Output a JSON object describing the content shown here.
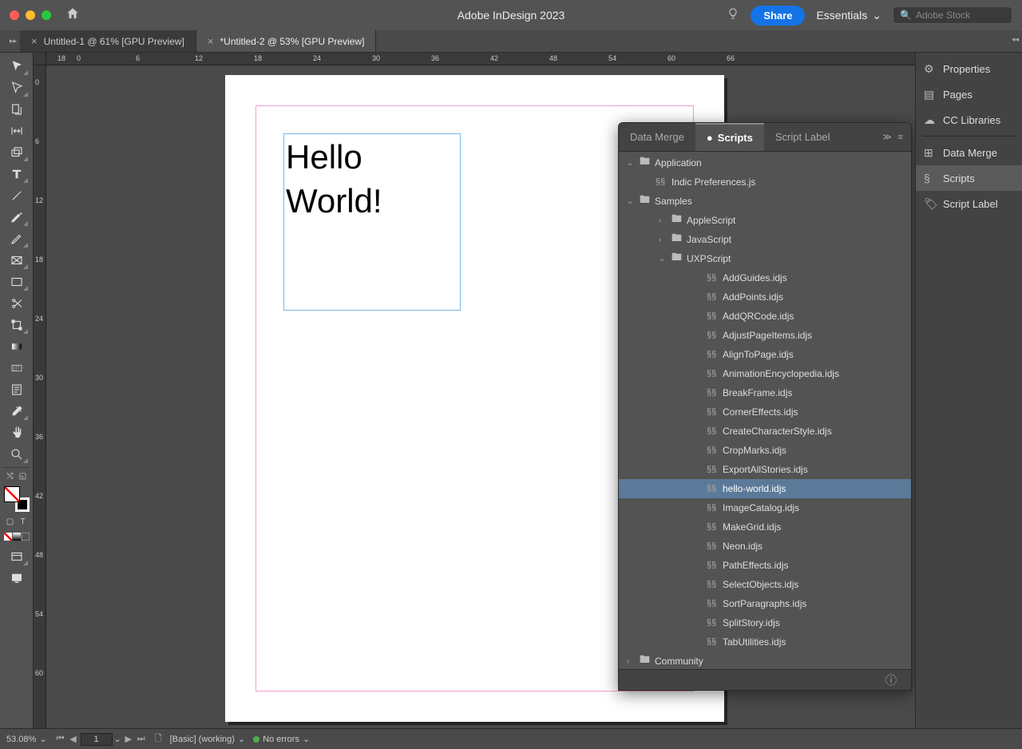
{
  "app": {
    "title": "Adobe InDesign 2023"
  },
  "titlebar": {
    "share_label": "Share",
    "workspace": "Essentials",
    "stock_placeholder": "Adobe Stock"
  },
  "tabs": [
    {
      "label": "Untitled-1 @ 61% [GPU Preview]",
      "active": false
    },
    {
      "label": "*Untitled-2 @ 53% [GPU Preview]",
      "active": true
    }
  ],
  "ruler": {
    "h": [
      "18",
      "0",
      "6",
      "12",
      "18",
      "24",
      "30",
      "36",
      "42",
      "48",
      "54",
      "60",
      "66"
    ],
    "v": [
      "0",
      "6",
      "12",
      "18",
      "24",
      "30",
      "36",
      "42",
      "48",
      "54",
      "60"
    ]
  },
  "document": {
    "text": "Hello World!"
  },
  "scripts_panel": {
    "tabs": [
      "Data Merge",
      "Scripts",
      "Script Label"
    ],
    "active_tab": "Scripts",
    "selected": "hello-world.idjs",
    "tree": {
      "application": {
        "label": "Application",
        "children": [
          "Indic Preferences.js"
        ]
      },
      "samples": {
        "label": "Samples",
        "folders": [
          {
            "label": "AppleScript",
            "expanded": false
          },
          {
            "label": "JavaScript",
            "expanded": false
          },
          {
            "label": "UXPScript",
            "expanded": true,
            "files": [
              "AddGuides.idjs",
              "AddPoints.idjs",
              "AddQRCode.idjs",
              "AdjustPageItems.idjs",
              "AlignToPage.idjs",
              "AnimationEncyclopedia.idjs",
              "BreakFrame.idjs",
              "CornerEffects.idjs",
              "CreateCharacterStyle.idjs",
              "CropMarks.idjs",
              "ExportAllStories.idjs",
              "hello-world.idjs",
              "ImageCatalog.idjs",
              "MakeGrid.idjs",
              "Neon.idjs",
              "PathEffects.idjs",
              "SelectObjects.idjs",
              "SortParagraphs.idjs",
              "SplitStory.idjs",
              "TabUtilities.idjs"
            ]
          }
        ]
      },
      "community": {
        "label": "Community"
      }
    }
  },
  "right_dock": [
    {
      "label": "Properties"
    },
    {
      "label": "Pages"
    },
    {
      "label": "CC Libraries"
    },
    {
      "label": "Data Merge"
    },
    {
      "label": "Scripts",
      "active": true
    },
    {
      "label": "Script Label"
    }
  ],
  "status": {
    "zoom": "53.08%",
    "page": "1",
    "style": "[Basic] (working)",
    "errors": "No errors"
  }
}
